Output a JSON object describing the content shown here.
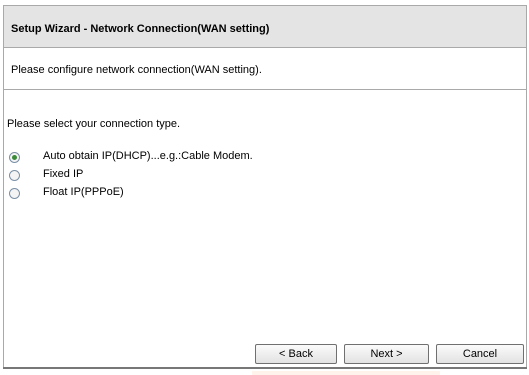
{
  "wizard": {
    "title": "Setup Wizard - Network Connection(WAN setting)",
    "subtitle": "Please configure network connection(WAN setting).",
    "prompt": "Please select your connection type.",
    "options": [
      {
        "label": "Auto obtain IP(DHCP)...e.g.:Cable Modem.",
        "checked": true
      },
      {
        "label": "Fixed IP",
        "checked": false
      },
      {
        "label": "Float IP(PPPoE)",
        "checked": false
      }
    ],
    "buttons": {
      "back": "< Back",
      "next": "Next >",
      "cancel": "Cancel"
    }
  },
  "colors": {
    "title_bar_bg": "#e4e4e4",
    "border": "#a9a9a9",
    "radio_checked_dot": "#3a8a3a"
  }
}
